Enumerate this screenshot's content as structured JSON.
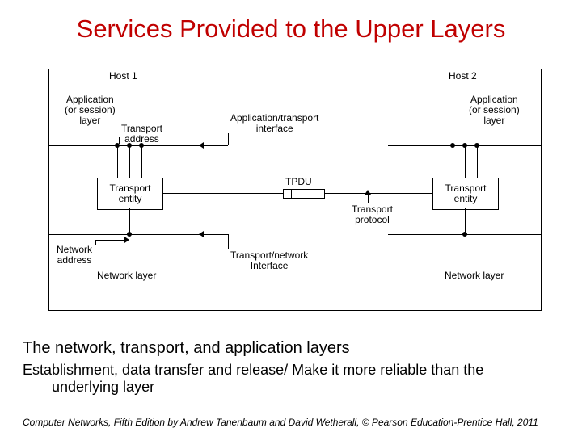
{
  "title": "Services Provided to the Upper Layers",
  "diagram": {
    "host1": "Host 1",
    "host2": "Host 2",
    "app_layer_left": "Application\n(or session)\nlayer",
    "app_layer_right": "Application\n(or session)\nlayer",
    "transport_address": "Transport\naddress",
    "app_transport_if": "Application/transport\ninterface",
    "transport_entity_left": "Transport\nentity",
    "transport_entity_right": "Transport\nentity",
    "tpdu": "TPDU",
    "transport_protocol": "Transport\nprotocol",
    "network_address": "Network\naddress",
    "transport_network_if": "Transport/network\nInterface",
    "network_layer_left": "Network layer",
    "network_layer_right": "Network layer"
  },
  "caption": "The network, transport, and application layers",
  "subcaption_line1": "Establishment, data transfer and release/ Make it more reliable than the",
  "subcaption_line2": "underlying layer",
  "footer": "Computer Networks, Fifth Edition by Andrew Tanenbaum and David Wetherall, © Pearson Education-Prentice Hall, 2011"
}
